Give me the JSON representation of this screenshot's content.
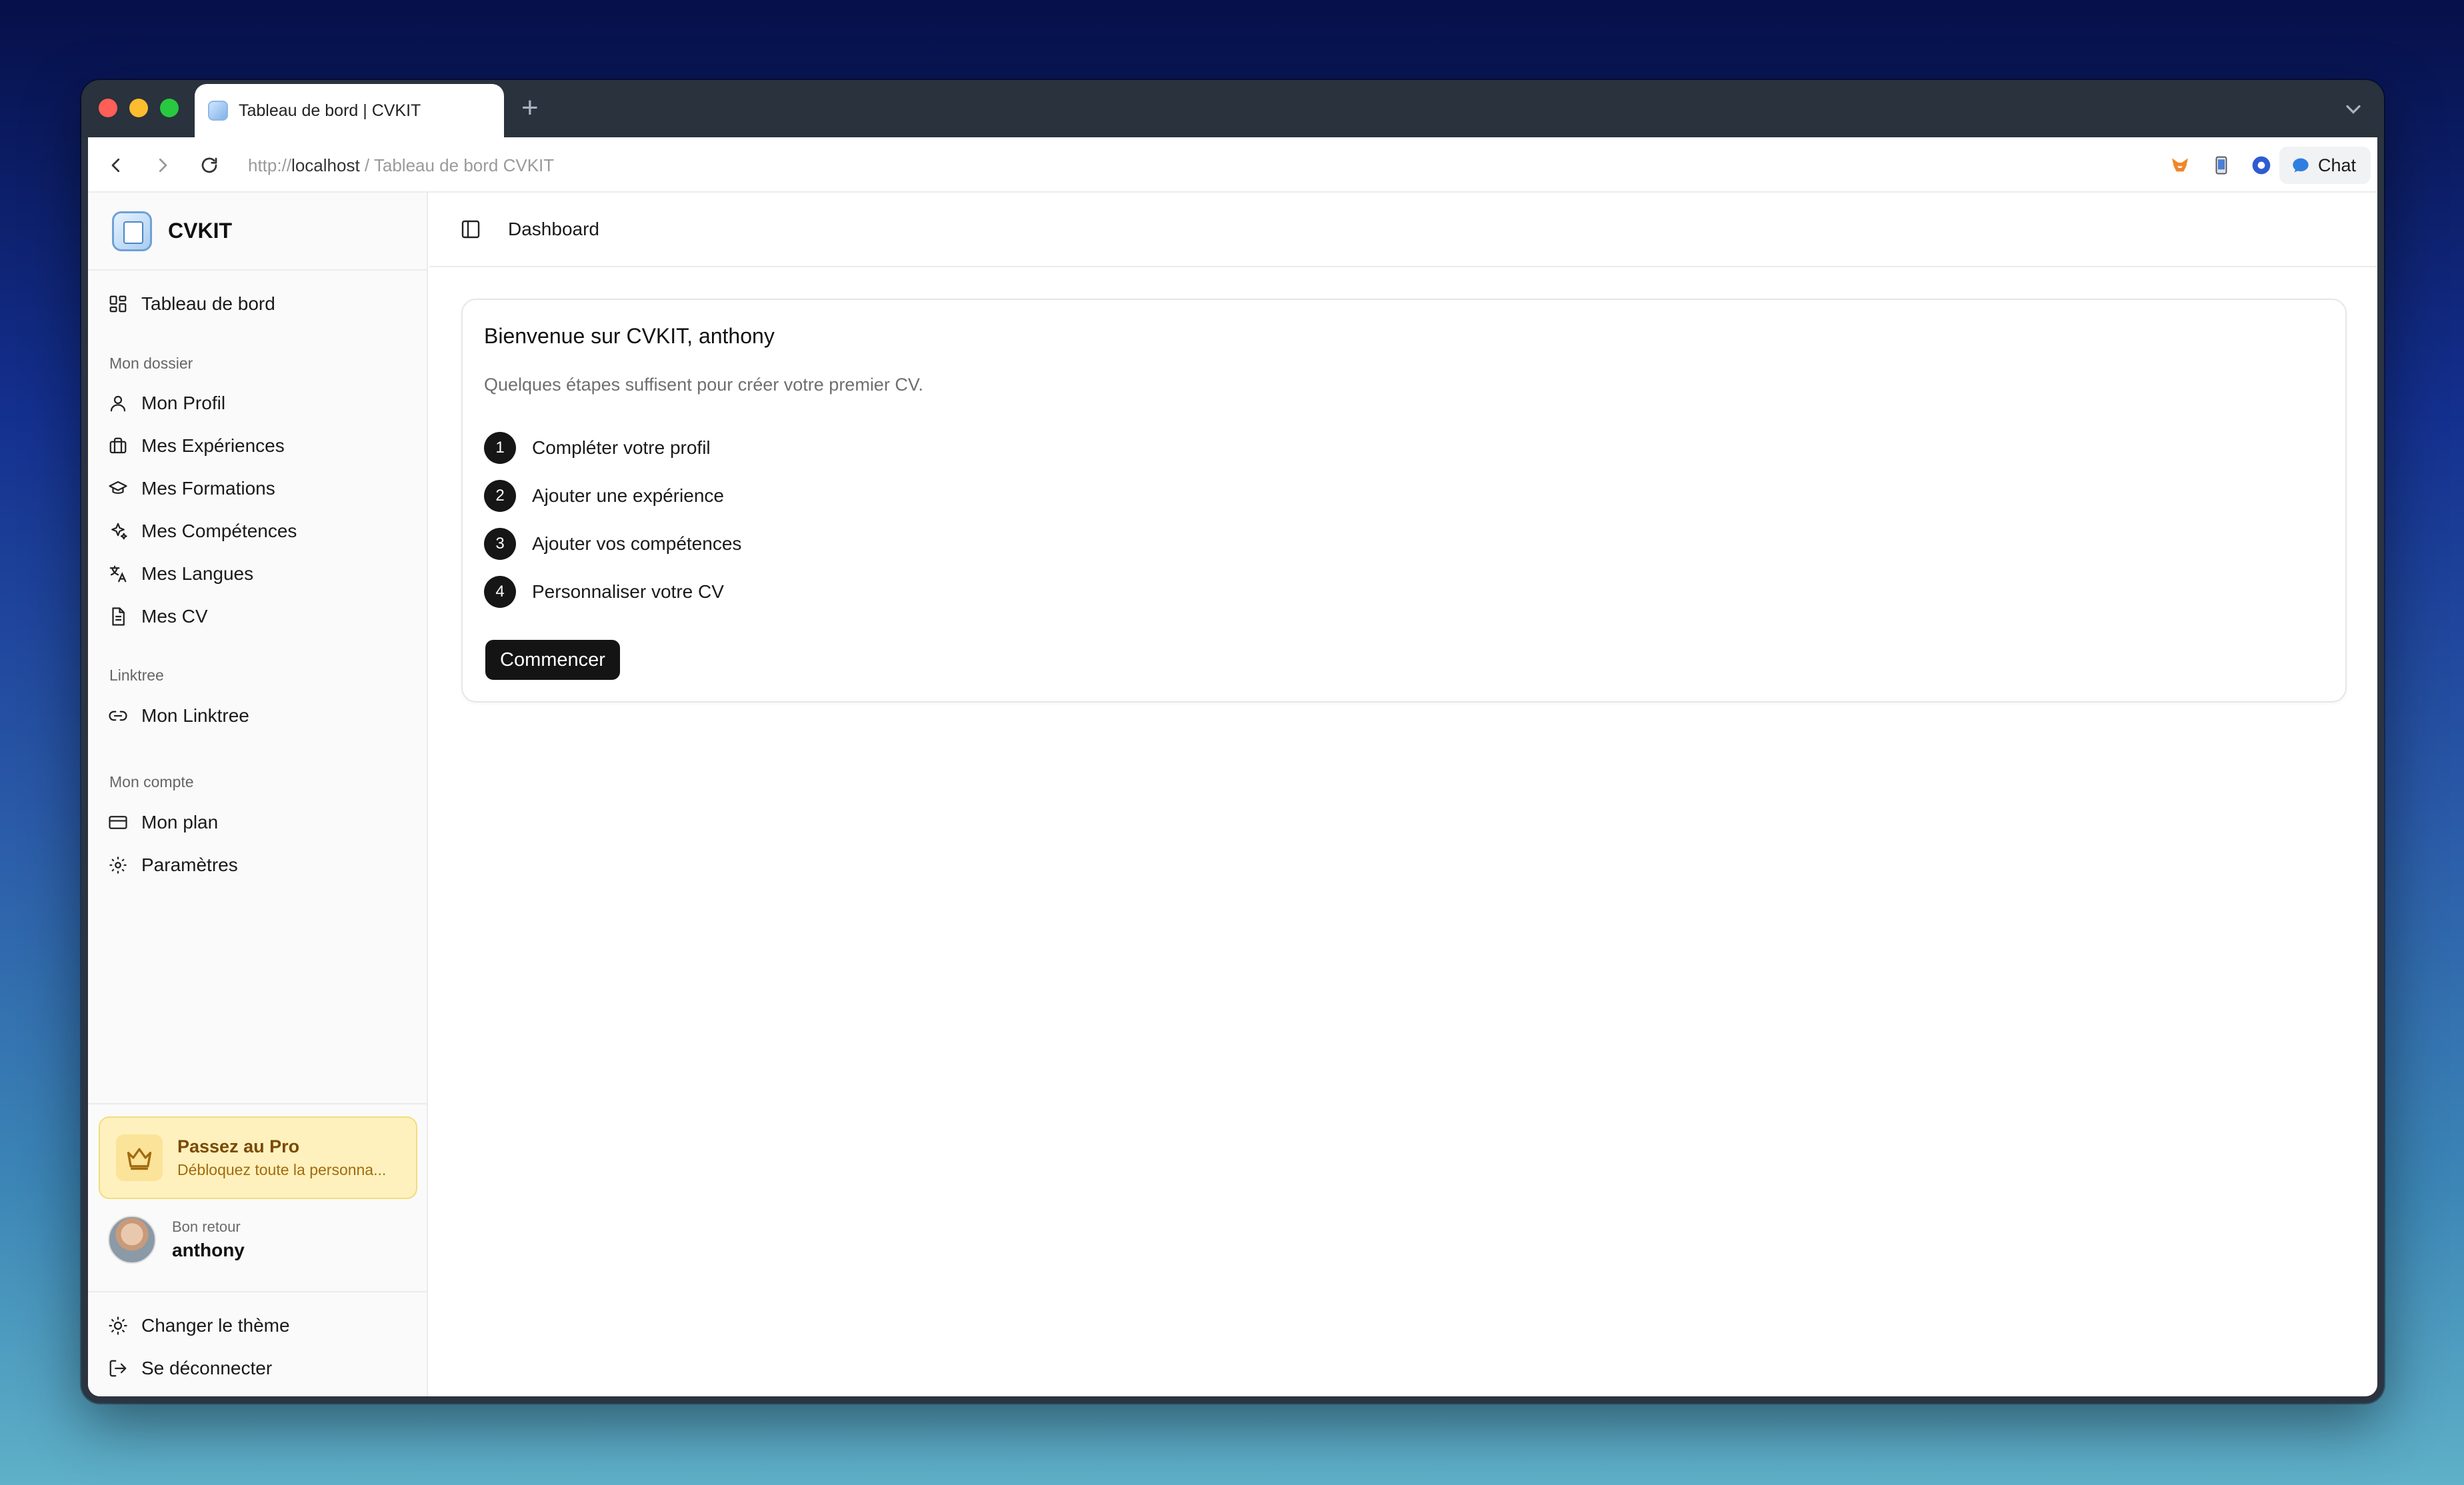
{
  "browser": {
    "tab_title": "Tableau de bord | CVKIT",
    "url_scheme": "http://",
    "url_host": "localhost",
    "url_path": " / Tableau de bord CVKIT",
    "chat_label": "Chat"
  },
  "sidebar": {
    "brand": "CVKIT",
    "dashboard_label": "Tableau de bord",
    "sections": [
      {
        "label": "Mon dossier",
        "items": [
          {
            "label": "Mon Profil",
            "icon": "user-icon"
          },
          {
            "label": "Mes Expériences",
            "icon": "briefcase-icon"
          },
          {
            "label": "Mes Formations",
            "icon": "graduation-cap-icon"
          },
          {
            "label": "Mes Compétences",
            "icon": "sparkles-icon"
          },
          {
            "label": "Mes Langues",
            "icon": "languages-icon"
          },
          {
            "label": "Mes CV",
            "icon": "file-text-icon"
          }
        ]
      },
      {
        "label": "Linktree",
        "items": [
          {
            "label": "Mon Linktree",
            "icon": "link-icon"
          }
        ]
      },
      {
        "label": "Mon compte",
        "items": [
          {
            "label": "Mon plan",
            "icon": "credit-card-icon"
          },
          {
            "label": "Paramètres",
            "icon": "gear-icon"
          }
        ]
      }
    ],
    "pro": {
      "title": "Passez au Pro",
      "subtitle": "Débloquez toute la personna..."
    },
    "user": {
      "greeting": "Bon retour",
      "name": "anthony"
    },
    "footer": {
      "theme_label": "Changer le thème",
      "logout_label": "Se déconnecter"
    }
  },
  "main": {
    "header_title": "Dashboard",
    "welcome": {
      "title": "Bienvenue sur CVKIT, anthony",
      "subtitle": "Quelques étapes suffisent pour créer votre premier CV.",
      "steps": [
        {
          "num": "1",
          "label": "Compléter votre profil"
        },
        {
          "num": "2",
          "label": "Ajouter une expérience"
        },
        {
          "num": "3",
          "label": "Ajouter vos compétences"
        },
        {
          "num": "4",
          "label": "Personnaliser votre CV"
        }
      ],
      "cta": "Commencer"
    }
  },
  "colors": {
    "accent_dark": "#141414",
    "pro_bg": "#fef1bd",
    "pro_text": "#7a4a07"
  }
}
